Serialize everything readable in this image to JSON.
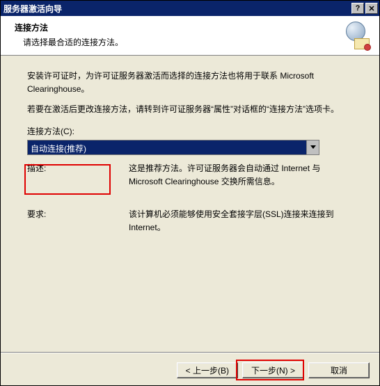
{
  "window": {
    "title": "服务器激活向导"
  },
  "header": {
    "title": "连接方法",
    "subtitle": "请选择最合适的连接方法。"
  },
  "body": {
    "para1": "安装许可证时，为许可证服务器激活而选择的连接方法也将用于联系 Microsoft Clearinghouse。",
    "para2": "若要在激活后更改连接方法，请转到许可证服务器“属性”对话框的“连接方法”选项卡。",
    "combo_label": "连接方法(C):",
    "combo_value": "自动连接(推荐)",
    "desc_label": "描述:",
    "desc_text": "这是推荐方法。许可证服务器会自动通过 Internet 与 Microsoft Clearinghouse 交换所需信息。",
    "req_label": "要求:",
    "req_text": "该计算机必须能够使用安全套接字层(SSL)连接来连接到 Internet。"
  },
  "footer": {
    "back": "< 上一步(B)",
    "next": "下一步(N) >",
    "cancel": "取消"
  },
  "icons": {
    "close": "✕",
    "help": "?"
  }
}
